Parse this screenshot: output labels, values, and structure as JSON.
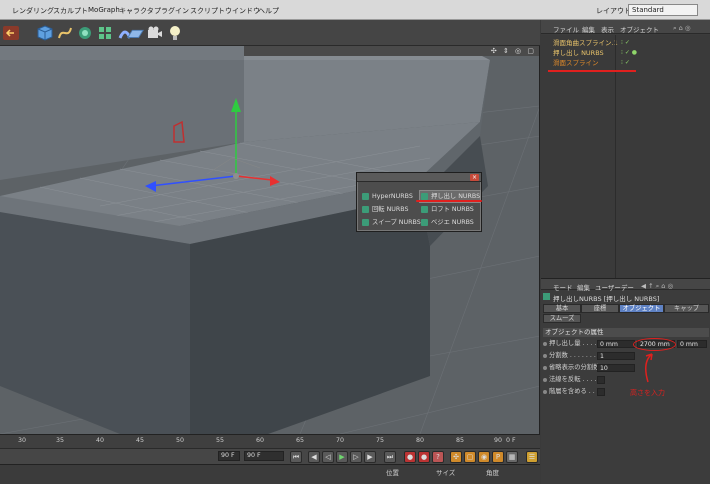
{
  "menubar": {
    "items": [
      "レンダリング",
      "スカルプト",
      "MoGraph",
      "キャラクタ",
      "プラグイン",
      "スクリプト",
      "ウインドウ",
      "ヘルプ"
    ],
    "layout_label": "レイアウト:",
    "layout_value": "Standard"
  },
  "toolbar": {
    "icons": [
      "undo-icon",
      "cube-icon",
      "spline-pen-icon",
      "nurbs-icon",
      "array-icon",
      "deformer-icon",
      "floor-icon",
      "camera-icon",
      "light-icon"
    ]
  },
  "viewport": {
    "nav_icons": "✣ ⇕ ◎ ▢"
  },
  "nurbs_popup": {
    "items": [
      {
        "label": "HyperNURBS"
      },
      {
        "label": "押し出し NURBS"
      },
      {
        "label": "回転 NURBS"
      },
      {
        "label": "ロフト NURBS"
      },
      {
        "label": "スイープ NURBS"
      },
      {
        "label": "ベジエ NURBS"
      }
    ],
    "close": "×"
  },
  "object_manager": {
    "menu": [
      "ファイル",
      "編集",
      "表示",
      "オブジェクト"
    ],
    "objects": [
      {
        "name": "滑面角曲スプライン.1",
        "color": "#e8c36a"
      },
      {
        "name": "押し出し NURBS",
        "color": "#e8c36a"
      },
      {
        "name": "滑面スプライン",
        "color": "#e08a2a"
      }
    ]
  },
  "attribute_manager": {
    "menu": [
      "モード",
      "編集",
      "ユーザーデー"
    ],
    "title": "押し出しNURBS [押し出し NURBS]",
    "tabs": [
      "基本",
      "座標",
      "オブジェクト",
      "キャップ",
      "スムーズ"
    ],
    "active_tab": "オブジェクト",
    "section": "オブジェクトの属性",
    "props": {
      "extrude_label": "押し出し量 . . . . . .",
      "extrude_x": "0 mm",
      "extrude_y": "2700 mm",
      "extrude_z": "0 mm",
      "subdiv_label": "分割数 . . . . . . . . .",
      "subdiv_value": "1",
      "iso_label": "省略表示の分割数",
      "iso_value": "10",
      "flip_label": "法線を反転 . . . . .",
      "hier_label": "階層を含める . . . ."
    }
  },
  "annotation": {
    "text": "高さを入力"
  },
  "timeline": {
    "ticks": [
      "30",
      "35",
      "40",
      "45",
      "50",
      "55",
      "60",
      "65",
      "70",
      "75",
      "80",
      "85",
      "90"
    ],
    "end_frame": "0 F"
  },
  "playbar": {
    "field_left": "90 F",
    "field_right": "90 F"
  },
  "coords": {
    "headers": [
      "位置",
      "サイズ",
      "角度"
    ]
  }
}
